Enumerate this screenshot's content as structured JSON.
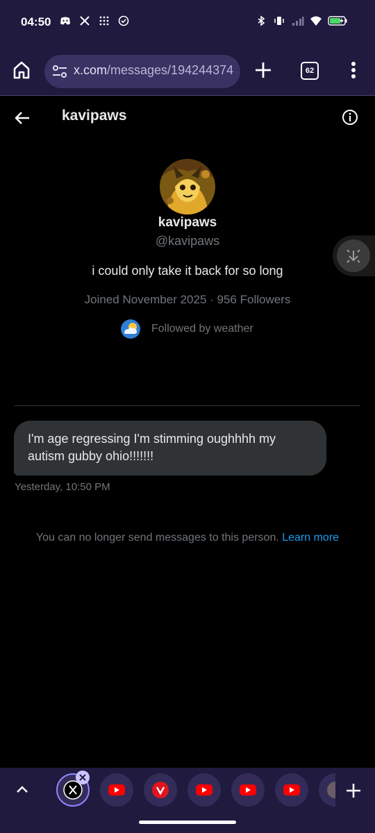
{
  "status": {
    "time": "04:50",
    "left_icons": [
      "discord-icon",
      "x-logo-icon",
      "grid-dots-icon",
      "check-circle-icon"
    ],
    "right_icons": [
      "bluetooth-icon",
      "vibrate-icon",
      "signal-icon",
      "wifi-icon",
      "battery-charging-icon"
    ]
  },
  "browser": {
    "url_domain": "x.com",
    "url_path": "/messages/194244374",
    "tab_count": "62"
  },
  "header": {
    "title": "kavipaws"
  },
  "profile": {
    "name": "kavipaws",
    "handle": "@kavipaws",
    "bio": "i could only take it back for so long",
    "meta": "Joined November 2025 · 956 Followers",
    "followed_by": "Followed by weather"
  },
  "conversation": {
    "messages": [
      {
        "text": "I'm age regressing I'm stimming oughhhh my autism gubby ohio!!!!!!!",
        "timestamp": "Yesterday, 10:50 PM"
      }
    ],
    "notice": "You can no longer send messages to this person.",
    "notice_link": "Learn more"
  },
  "tabstrip": {
    "tabs": [
      "x-logo-icon",
      "youtube-icon",
      "app-icon",
      "youtube-icon",
      "youtube-icon",
      "youtube-icon",
      "partial-tab-icon"
    ]
  },
  "colors": {
    "chrome_bg": "#1f1a3e",
    "url_pill": "#3a3263",
    "link_blue": "#1d9bf0",
    "bubble": "#2f3336",
    "youtube_red": "#ff0000"
  }
}
